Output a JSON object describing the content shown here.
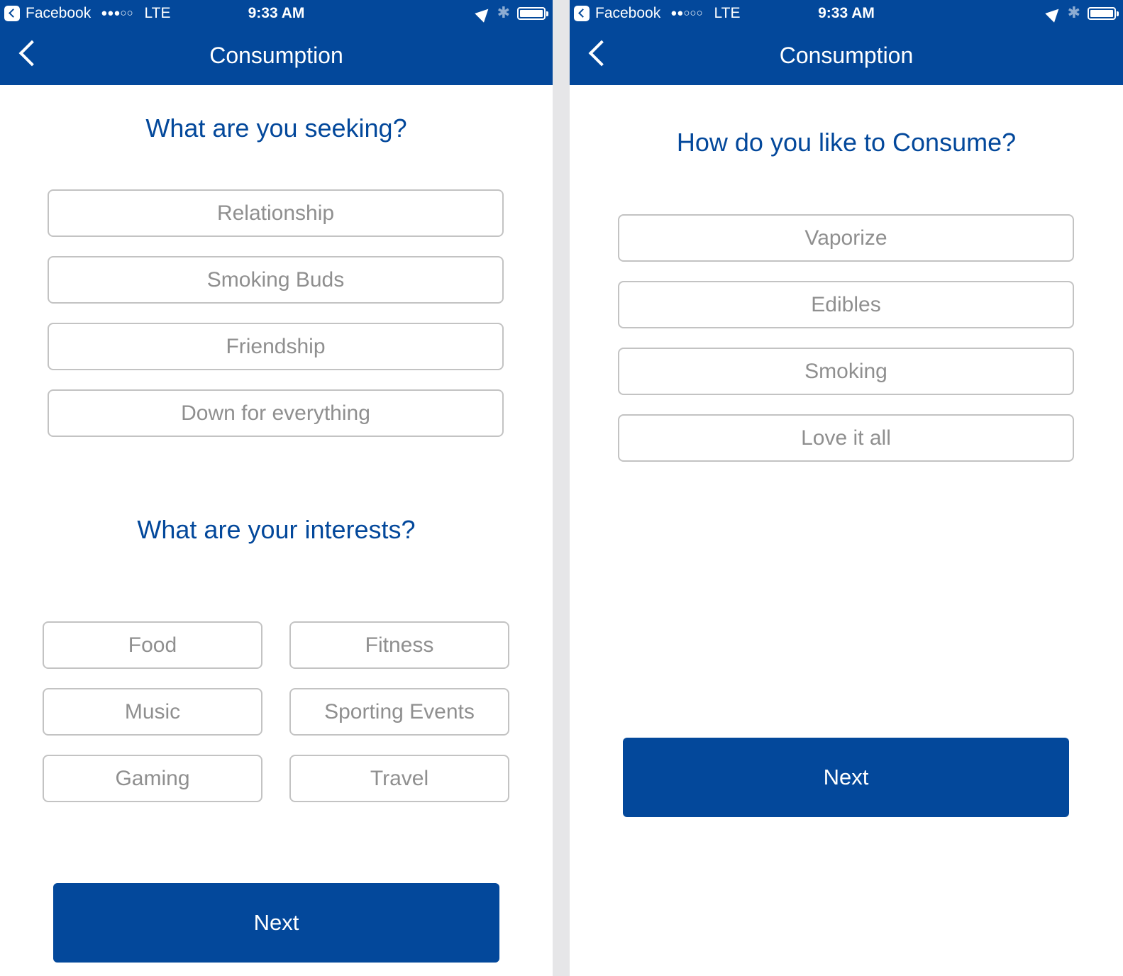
{
  "status_bar": {
    "back_app": "Facebook",
    "signal_left": "●●●○○",
    "signal_right": "●●○○○",
    "network": "LTE",
    "time": "9:33 AM",
    "bluetooth_icon": "✱"
  },
  "left_screen": {
    "title": "Consumption",
    "seeking": {
      "question": "What are you seeking?",
      "options": [
        "Relationship",
        "Smoking Buds",
        "Friendship",
        "Down for everything"
      ]
    },
    "interests": {
      "question": "What are your interests?",
      "options": [
        "Food",
        "Fitness",
        "Music",
        "Sporting Events",
        "Gaming",
        "Travel"
      ]
    },
    "next_label": "Next"
  },
  "right_screen": {
    "title": "Consumption",
    "consume": {
      "question": "How do you like to Consume?",
      "options": [
        "Vaporize",
        "Edibles",
        "Smoking",
        "Love it all"
      ]
    },
    "next_label": "Next"
  },
  "colors": {
    "brand_blue": "#03489b",
    "option_border": "#c3c3c3",
    "option_text": "#8f8f8f",
    "divider": "#e6e6e8"
  }
}
